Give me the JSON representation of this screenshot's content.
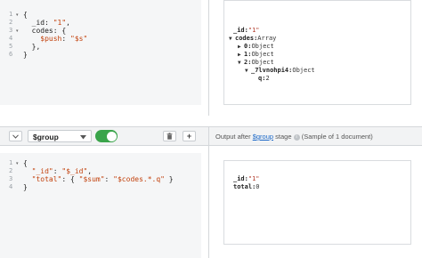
{
  "top_editor": {
    "lines": [
      {
        "n": "1",
        "fold": "▾",
        "text": "{"
      },
      {
        "n": "2",
        "fold": "",
        "text": "  _id: \"1\","
      },
      {
        "n": "3",
        "fold": "▾",
        "text": "  codes: {"
      },
      {
        "n": "4",
        "fold": "",
        "text": "    $push: \"$s\""
      },
      {
        "n": "5",
        "fold": "",
        "text": "  },"
      },
      {
        "n": "6",
        "fold": "",
        "text": "}"
      }
    ]
  },
  "top_result": {
    "lines": [
      {
        "tri": "",
        "key": "_id:",
        "val": "\"1\"",
        "kind": "str"
      },
      {
        "tri": "▼",
        "key": "codes:",
        "val": "Array",
        "kind": "plain"
      },
      {
        "tri": "▶",
        "key": "0:",
        "val": "Object",
        "kind": "plain"
      },
      {
        "tri": "▶",
        "key": "1:",
        "val": "Object",
        "kind": "plain"
      },
      {
        "tri": "▼",
        "key": "2:",
        "val": "Object",
        "kind": "plain"
      },
      {
        "tri": "▼",
        "key": "_7lvnohpi4:",
        "val": "Object",
        "kind": "plain"
      },
      {
        "tri": "",
        "key": "q:",
        "val": "2",
        "kind": "plain"
      }
    ]
  },
  "stage_bar": {
    "collapse_icon": "chevron-down-icon",
    "operator": "$group",
    "delete_icon": "trash-icon",
    "add_icon": "+",
    "toggle_on": true,
    "output_prefix": "Output after",
    "output_stage": "$group",
    "output_suffix": "stage",
    "output_sample": "(Sample of 1 document)"
  },
  "bottom_editor": {
    "lines": [
      {
        "n": "1",
        "fold": "▾",
        "text": "{"
      },
      {
        "n": "2",
        "fold": "",
        "text": "  \"_id\": \"$_id\","
      },
      {
        "n": "3",
        "fold": "",
        "text": "  \"total\": { \"$sum\": \"$codes.*.q\" }"
      },
      {
        "n": "4",
        "fold": "",
        "text": "}"
      }
    ]
  },
  "bottom_result": {
    "lines": [
      {
        "key": "_id:",
        "val": "\"1\"",
        "kind": "str"
      },
      {
        "key": "total:",
        "val": "0",
        "kind": "plain"
      }
    ]
  },
  "colors": {
    "toggle": "#3aa44a",
    "link": "#1a67c7",
    "string_value": "#c2410c"
  }
}
